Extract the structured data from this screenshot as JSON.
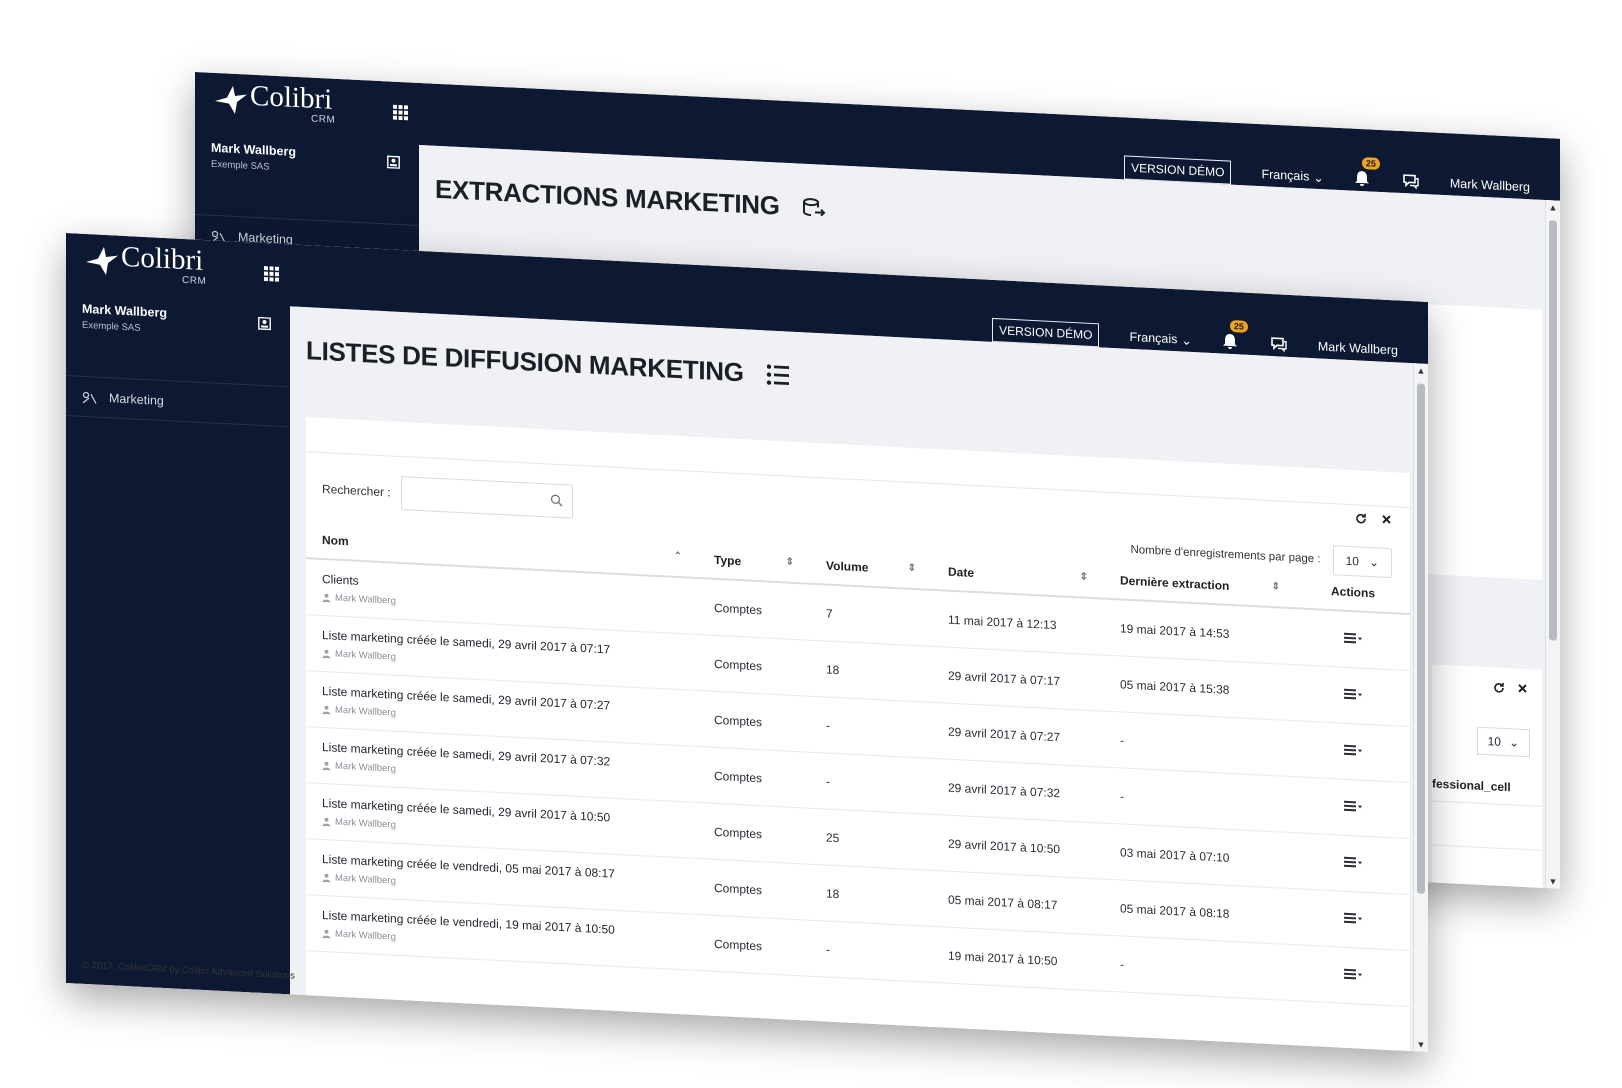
{
  "brand": {
    "name": "Colibri",
    "sub": "CRM"
  },
  "topbar": {
    "demo_label": "VERSION DÉMO",
    "language": "Français",
    "notif_count": "25",
    "user": "Mark Wallberg"
  },
  "sidebar": {
    "user_name": "Mark Wallberg",
    "company": "Exemple SAS",
    "items": [
      {
        "label": "Marketing"
      }
    ]
  },
  "back_window": {
    "title": "EXTRACTIONS MARKETING",
    "per_page": "10",
    "partial_column": "fessional_cell"
  },
  "front_window": {
    "title": "LISTES DE DIFFUSION MARKETING",
    "search_label": "Rechercher :",
    "search_value": "",
    "per_page_label": "Nombre d'enregistrements par page :",
    "per_page": "10",
    "columns": {
      "name": "Nom",
      "type": "Type",
      "volume": "Volume",
      "date": "Date",
      "last": "Dernière extraction",
      "actions": "Actions"
    },
    "rows": [
      {
        "name": "Clients",
        "owner": "Mark Wallberg",
        "type": "Comptes",
        "volume": "7",
        "date": "11 mai 2017 à 12:13",
        "last": "19 mai 2017 à 14:53"
      },
      {
        "name": "Liste marketing créée le samedi, 29 avril 2017 à 07:17",
        "owner": "Mark Wallberg",
        "type": "Comptes",
        "volume": "18",
        "date": "29 avril 2017 à 07:17",
        "last": "05 mai 2017 à 15:38"
      },
      {
        "name": "Liste marketing créée le samedi, 29 avril 2017 à 07:27",
        "owner": "Mark Wallberg",
        "type": "Comptes",
        "volume": "-",
        "date": "29 avril 2017 à 07:27",
        "last": "-"
      },
      {
        "name": "Liste marketing créée le samedi, 29 avril 2017 à 07:32",
        "owner": "Mark Wallberg",
        "type": "Comptes",
        "volume": "-",
        "date": "29 avril 2017 à 07:32",
        "last": "-"
      },
      {
        "name": "Liste marketing créée le samedi, 29 avril 2017 à 10:50",
        "owner": "Mark Wallberg",
        "type": "Comptes",
        "volume": "25",
        "date": "29 avril 2017 à 10:50",
        "last": "03 mai 2017 à 07:10"
      },
      {
        "name": "Liste marketing créée le vendredi, 05 mai 2017 à 08:17",
        "owner": "Mark Wallberg",
        "type": "Comptes",
        "volume": "18",
        "date": "05 mai 2017 à 08:17",
        "last": "05 mai 2017 à 08:18"
      },
      {
        "name": "Liste marketing créée le vendredi, 19 mai 2017 à 10:50",
        "owner": "Mark Wallberg",
        "type": "Comptes",
        "volume": "-",
        "date": "19 mai 2017 à 10:50",
        "last": "-"
      }
    ]
  },
  "footer": {
    "text": "© 2017. ColibriCRM by Colibri Advanced Solutions"
  },
  "icons": {
    "grid": "grid-icon",
    "bell": "bell-icon",
    "chat": "chat-icon",
    "profile": "profile-card-icon",
    "marketing": "marketing-icon",
    "list": "list-icon",
    "export": "database-export-icon",
    "refresh": "refresh-icon",
    "close": "close-icon",
    "search": "search-icon",
    "actions": "actions-menu-icon"
  },
  "colors": {
    "navy": "#0d1833",
    "badge": "#f0a31c",
    "background": "#f0f1f4"
  }
}
